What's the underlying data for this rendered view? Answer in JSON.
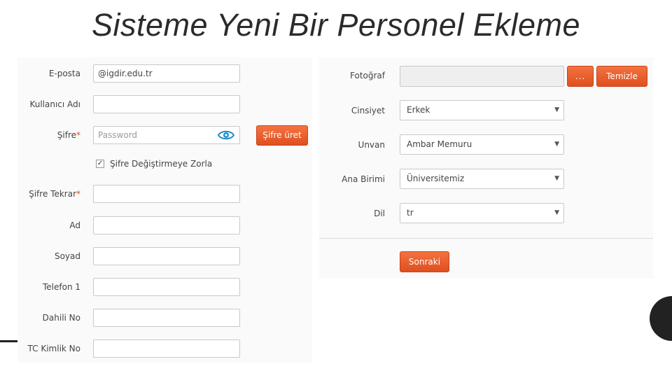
{
  "title": "Sisteme Yeni Bir Personel Ekleme",
  "left_form": {
    "email": {
      "label": "E-posta",
      "value": "@igdir.edu.tr"
    },
    "username": {
      "label": "Kullanıcı Adı",
      "value": ""
    },
    "password": {
      "label": "Şifre",
      "required_mark": "*",
      "placeholder": "Password",
      "generate_label": "Şifre üret"
    },
    "force_change": {
      "label": "Şifre Değiştirmeye Zorla",
      "checked": true,
      "check_glyph": "✓"
    },
    "password_repeat": {
      "label": "Şifre Tekrar",
      "required_mark": "*",
      "value": ""
    },
    "first_name": {
      "label": "Ad",
      "value": ""
    },
    "last_name": {
      "label": "Soyad",
      "value": ""
    },
    "phone1": {
      "label": "Telefon 1",
      "value": ""
    },
    "extension": {
      "label": "Dahili No",
      "value": ""
    },
    "national_id": {
      "label": "TC Kimlik No",
      "value": ""
    }
  },
  "right_form": {
    "photo": {
      "label": "Fotoğraf",
      "value": "",
      "browse_label": "...",
      "clear_label": "Temizle"
    },
    "gender": {
      "label": "Cinsiyet",
      "selected": "Erkek"
    },
    "title": {
      "label": "Unvan",
      "selected": "Ambar Memuru"
    },
    "main_unit": {
      "label": "Ana Birimi",
      "selected": "Üniversitemiz"
    },
    "language": {
      "label": "Dil",
      "selected": "tr"
    },
    "next_label": "Sonraki",
    "caret": "▼"
  },
  "colors": {
    "accent": "#e8592a",
    "eye_icon": "#1f8fc9"
  },
  "icons": {
    "password_visibility": "eye-icon",
    "dropdown": "chevron-down-icon",
    "checkbox": "check-icon"
  }
}
